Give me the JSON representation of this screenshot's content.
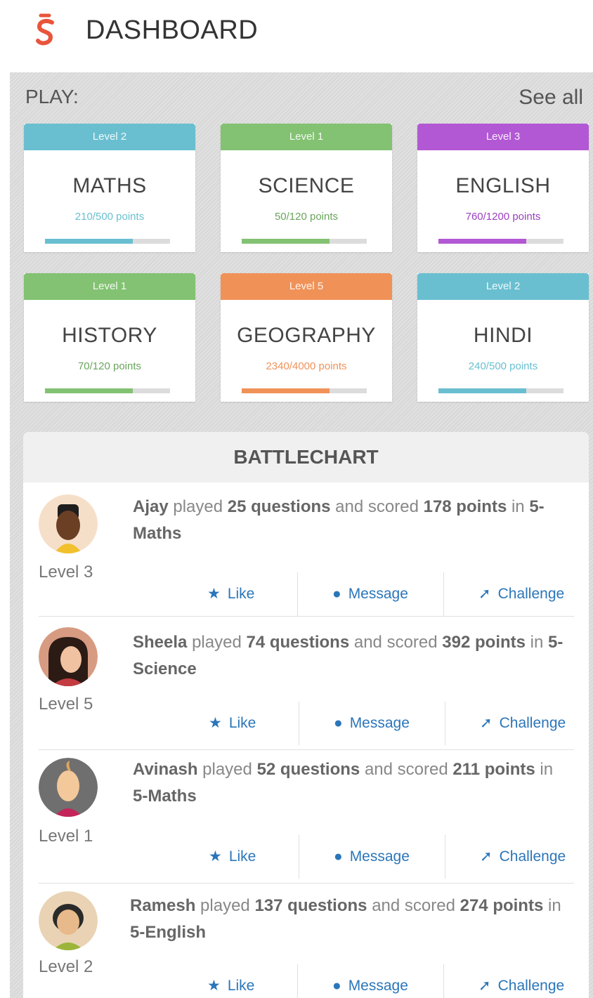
{
  "header": {
    "title": "DASHBOARD",
    "logo": "brand-logo-icon"
  },
  "play": {
    "label": "PLAY:",
    "see_all": "See all"
  },
  "cards": [
    {
      "level": "Level 2",
      "subject": "MATHS",
      "points": "210/500 points",
      "progress": 0.7,
      "color": "#69bfd0"
    },
    {
      "level": "Level 1",
      "subject": "SCIENCE",
      "points": "50/120 points",
      "progress": 0.7,
      "color": "#82c272"
    },
    {
      "level": "Level 3",
      "subject": "ENGLISH",
      "points": "760/1200 points",
      "progress": 0.7,
      "color": "#b258d4"
    },
    {
      "level": "Level 1",
      "subject": "HISTORY",
      "points": "70/120 points",
      "progress": 0.7,
      "color": "#82c272"
    },
    {
      "level": "Level 5",
      "subject": "GEOGRAPHY",
      "points": "2340/4000 points",
      "progress": 0.7,
      "color": "#f09258"
    },
    {
      "level": "Level 2",
      "subject": "HINDI",
      "points": "240/500 points",
      "progress": 0.7,
      "color": "#69bfd0"
    }
  ],
  "battlechart": {
    "title": "BATTLECHART",
    "actions": {
      "like": "Like",
      "message": "Message",
      "challenge": "Challenge"
    },
    "entries": [
      {
        "name": "Ajay",
        "played": "played",
        "questions": "25 questions",
        "and_scored": "and scored",
        "points": "178 points",
        "in": "in",
        "subject": "5-Maths",
        "level": "Level 3"
      },
      {
        "name": "Sheela",
        "played": "played",
        "questions": "74 questions",
        "and_scored": "and scored",
        "points": "392 points",
        "in": "in",
        "subject": "5-Science",
        "level": "Level 5"
      },
      {
        "name": "Avinash",
        "played": "played",
        "questions": "52 questions",
        "and_scored": "and scored",
        "points": "211 points",
        "in": "in",
        "subject": "5-Maths",
        "level": "Level 1"
      },
      {
        "name": "Ramesh",
        "played": "played",
        "questions": "137 questions",
        "and_scored": "and scored",
        "points": "274 points",
        "in": "in",
        "subject": "5-English",
        "level": "Level 2"
      }
    ]
  }
}
